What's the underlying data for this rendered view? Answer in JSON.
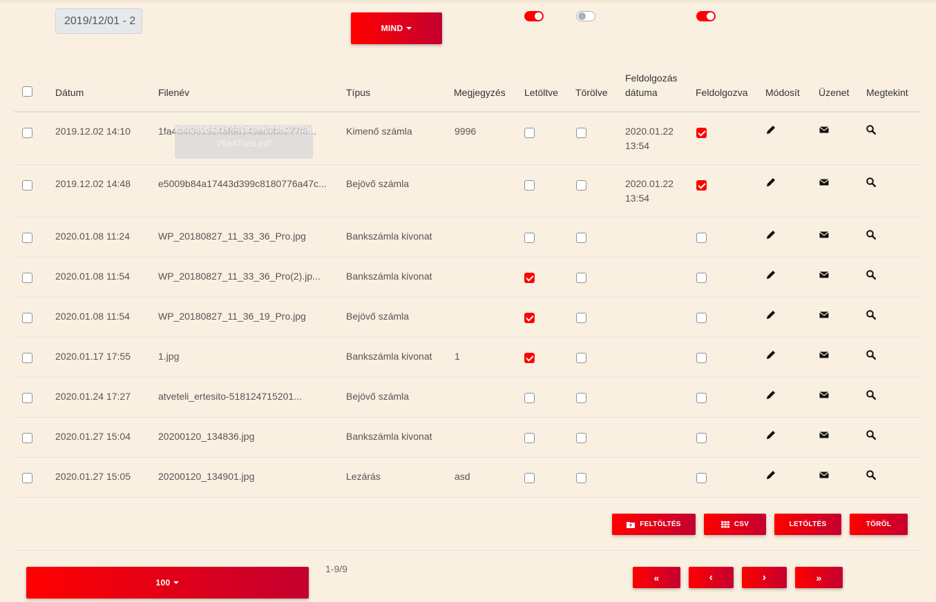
{
  "filters": {
    "date_range": "2019/12/01 - 2",
    "type_dropdown": "MIND"
  },
  "table": {
    "headers": {
      "datum": "Dátum",
      "filenev": "Filenév",
      "tipus": "Típus",
      "megjegyzes": "Megjegyzés",
      "letoltve": "Letöltve",
      "torolve": "Törölve",
      "feldolgozas_datuma_1": "Feldolgozás",
      "feldolgozas_datuma_2": "dátuma",
      "feldolgozva": "Feldolgozva",
      "modosit": "Módosít",
      "uzenet": "Üzenet",
      "megtekint": "Megtekint"
    },
    "rows": [
      {
        "datum": "2019.12.02 14:10",
        "filenev": "1fa4d4f361924af6b149ac0b8277f8...",
        "tipus": "Kimenő számla",
        "megjegyzes": "9996",
        "letoltve": false,
        "torolve": false,
        "feld_datum_1": "2020.01.22",
        "feld_datum_2": "13:54",
        "feldolgozva": true
      },
      {
        "datum": "2019.12.02 14:48",
        "filenev": "e5009b84a17443d399c8180776a47c...",
        "tipus": "Bejövő számla",
        "megjegyzes": "",
        "letoltve": false,
        "torolve": false,
        "feld_datum_1": "2020.01.22",
        "feld_datum_2": "13:54",
        "feldolgozva": true
      },
      {
        "datum": "2020.01.08 11:24",
        "filenev": "WP_20180827_11_33_36_Pro.jpg",
        "tipus": "Bankszámla kivonat",
        "megjegyzes": "",
        "letoltve": false,
        "torolve": false,
        "feld_datum_1": "",
        "feld_datum_2": "",
        "feldolgozva": false
      },
      {
        "datum": "2020.01.08 11:54",
        "filenev": "WP_20180827_11_33_36_Pro(2).jp...",
        "tipus": "Bankszámla kivonat",
        "megjegyzes": "",
        "letoltve": true,
        "torolve": false,
        "feld_datum_1": "",
        "feld_datum_2": "",
        "feldolgozva": false
      },
      {
        "datum": "2020.01.08 11:54",
        "filenev": "WP_20180827_11_36_19_Pro.jpg",
        "tipus": "Bejövő számla",
        "megjegyzes": "",
        "letoltve": true,
        "torolve": false,
        "feld_datum_1": "",
        "feld_datum_2": "",
        "feldolgozva": false
      },
      {
        "datum": "2020.01.17 17:55",
        "filenev": "1.jpg",
        "tipus": "Bankszámla kivonat",
        "megjegyzes": "1",
        "letoltve": true,
        "torolve": false,
        "feld_datum_1": "",
        "feld_datum_2": "",
        "feldolgozva": false
      },
      {
        "datum": "2020.01.24 17:27",
        "filenev": "atveteli_ertesito-518124715201...",
        "tipus": "Bejövő számla",
        "megjegyzes": "",
        "letoltve": false,
        "torolve": false,
        "feld_datum_1": "",
        "feld_datum_2": "",
        "feldolgozva": false
      },
      {
        "datum": "2020.01.27 15:04",
        "filenev": "20200120_134836.jpg",
        "tipus": "Bankszámla kivonat",
        "megjegyzes": "",
        "letoltve": false,
        "torolve": false,
        "feld_datum_1": "",
        "feld_datum_2": "",
        "feldolgozva": false
      },
      {
        "datum": "2020.01.27 15:05",
        "filenev": "20200120_134901.jpg",
        "tipus": "Lezárás",
        "megjegyzes": "asd",
        "letoltve": false,
        "torolve": false,
        "feld_datum_1": "",
        "feld_datum_2": "",
        "feldolgozva": false
      }
    ]
  },
  "tooltip": {
    "line1": "e5009b84a17443d399c8180776a47cea.pdf",
    "line2": "76a47cea.pdf"
  },
  "actions": {
    "upload_label": "FELTÖLTÉS",
    "csv_label": "CSV",
    "download_label": "LETÖLTÉS",
    "delete_label": "TÖRÖL"
  },
  "pagination": {
    "page_size": "100",
    "range_text": "1-9/9",
    "first_label": "«",
    "prev_label": "‹",
    "next_label": "›",
    "last_label": "»"
  },
  "colors": {
    "accent": "#ff0000",
    "accent_dark": "#c4002f",
    "background": "#faf0e1"
  },
  "toggles": [
    true,
    false,
    true
  ]
}
